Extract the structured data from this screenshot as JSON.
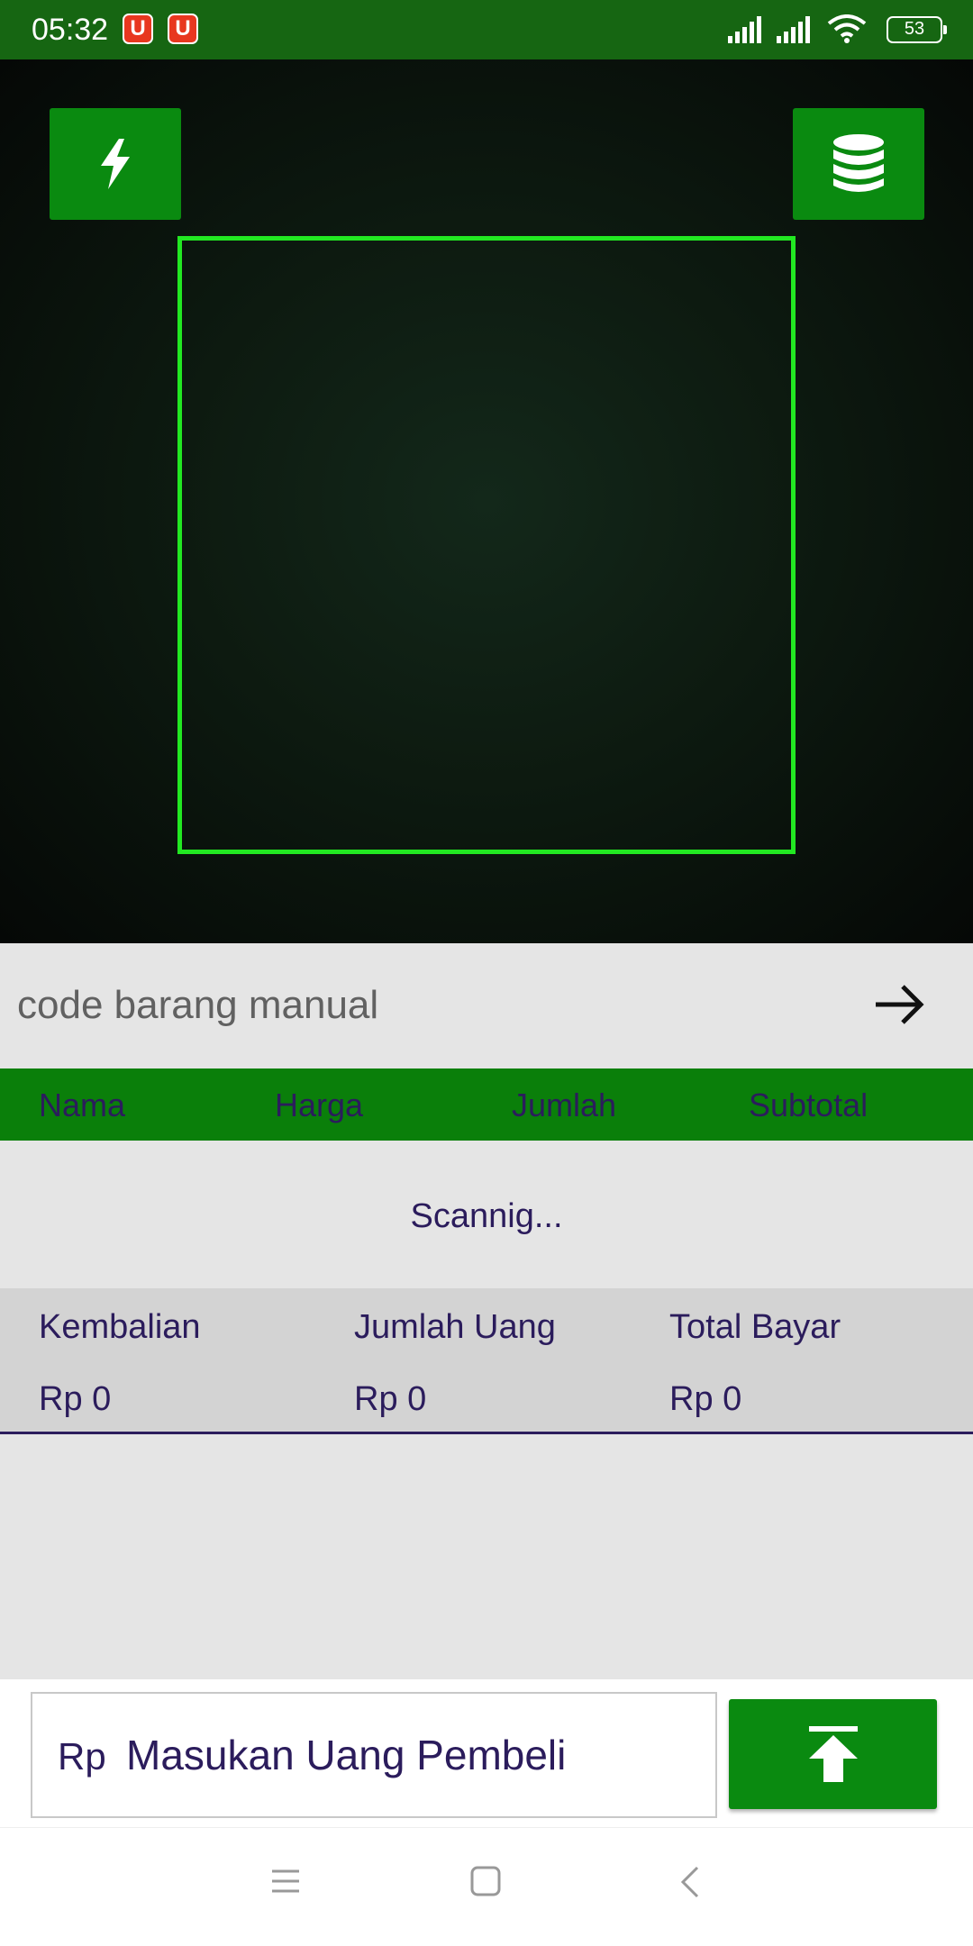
{
  "status_bar": {
    "time": "05:32",
    "notification_icons": [
      "U",
      "U"
    ],
    "battery": "53"
  },
  "camera": {
    "flash_icon": "flash-icon",
    "database_icon": "database-icon",
    "frame_color": "#22e822"
  },
  "manual": {
    "placeholder": "code barang manual",
    "submit_icon": "arrow-right-icon"
  },
  "table": {
    "headers": [
      "Nama",
      "Harga",
      "Jumlah",
      "Subtotal"
    ],
    "status": "Scannig..."
  },
  "totals": {
    "kembalian": {
      "label": "Kembalian",
      "value": "Rp 0"
    },
    "jumlah_uang": {
      "label": "Jumlah Uang",
      "value": "Rp 0"
    },
    "total_bayar": {
      "label": "Total Bayar",
      "value": "Rp 0"
    }
  },
  "payment": {
    "prefix": "Rp",
    "placeholder": "Masukan Uang Pembeli",
    "submit_icon": "upload-icon"
  },
  "colors": {
    "primary_green": "#0a8a10",
    "status_bar": "#166612",
    "text": "#2b1c5c"
  }
}
